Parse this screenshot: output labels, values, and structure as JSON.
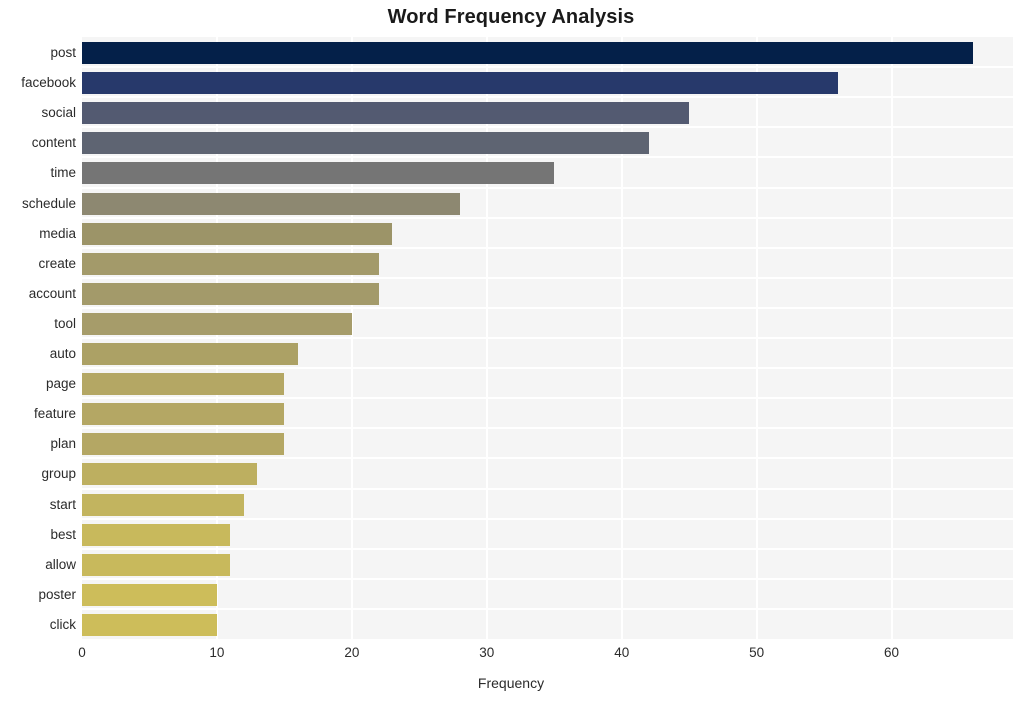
{
  "chart_data": {
    "type": "bar",
    "orientation": "horizontal",
    "title": "Word Frequency Analysis",
    "xlabel": "Frequency",
    "ylabel": "",
    "xlim": [
      0,
      69
    ],
    "xticks": [
      0,
      10,
      20,
      30,
      40,
      50,
      60
    ],
    "grid": true,
    "grid_axis": "x",
    "legend": false,
    "background": "#f5f5f5",
    "categories": [
      "post",
      "facebook",
      "social",
      "content",
      "time",
      "schedule",
      "media",
      "create",
      "account",
      "tool",
      "auto",
      "page",
      "feature",
      "plan",
      "group",
      "start",
      "best",
      "allow",
      "poster",
      "click"
    ],
    "values": [
      66,
      56,
      45,
      42,
      35,
      28,
      23,
      22,
      22,
      20,
      16,
      15,
      15,
      15,
      13,
      12,
      11,
      11,
      10,
      10
    ],
    "colors": [
      "#042049",
      "#27396b",
      "#535a71",
      "#5e6472",
      "#757575",
      "#8d8871",
      "#9c9468",
      "#a39a6a",
      "#a39a6a",
      "#a69c6a",
      "#aca165",
      "#b4a764",
      "#b4a764",
      "#b4a764",
      "#bdaf60",
      "#c2b45f",
      "#c8b95c",
      "#c8b95c",
      "#cdbd5a",
      "#cdbd5a"
    ],
    "bars": [
      {
        "label": "post",
        "value": 66,
        "color": "#042049"
      },
      {
        "label": "facebook",
        "value": 56,
        "color": "#27396b"
      },
      {
        "label": "social",
        "value": 45,
        "color": "#535a71"
      },
      {
        "label": "content",
        "value": 42,
        "color": "#5e6472"
      },
      {
        "label": "time",
        "value": 35,
        "color": "#757575"
      },
      {
        "label": "schedule",
        "value": 28,
        "color": "#8d8871"
      },
      {
        "label": "media",
        "value": 23,
        "color": "#9c9468"
      },
      {
        "label": "create",
        "value": 22,
        "color": "#a39a6a"
      },
      {
        "label": "account",
        "value": 22,
        "color": "#a39a6a"
      },
      {
        "label": "tool",
        "value": 20,
        "color": "#a69c6a"
      },
      {
        "label": "auto",
        "value": 16,
        "color": "#aca165"
      },
      {
        "label": "page",
        "value": 15,
        "color": "#b4a764"
      },
      {
        "label": "feature",
        "value": 15,
        "color": "#b4a764"
      },
      {
        "label": "plan",
        "value": 15,
        "color": "#b4a764"
      },
      {
        "label": "group",
        "value": 13,
        "color": "#bdaf60"
      },
      {
        "label": "start",
        "value": 12,
        "color": "#c2b45f"
      },
      {
        "label": "best",
        "value": 11,
        "color": "#c8b95c"
      },
      {
        "label": "allow",
        "value": 11,
        "color": "#c8b95c"
      },
      {
        "label": "poster",
        "value": 10,
        "color": "#cdbd5a"
      },
      {
        "label": "click",
        "value": 10,
        "color": "#cdbd5a"
      }
    ]
  }
}
